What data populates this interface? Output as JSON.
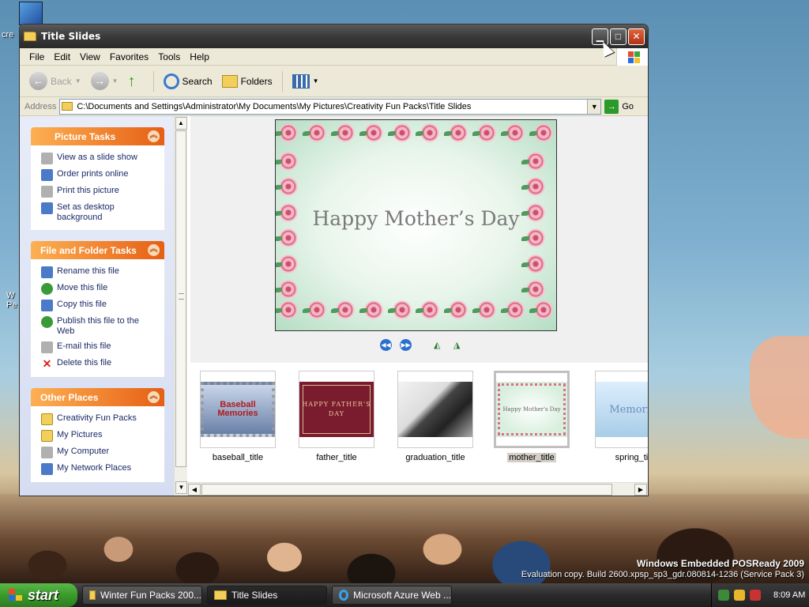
{
  "desktop": {
    "icon_label": "cre",
    "frag1": "W",
    "frag2": "Pe",
    "watermark_line1": "Windows Embedded POSReady 2009",
    "watermark_line2": "Evaluation copy. Build 2600.xpsp_sp3_gdr.080814-1236 (Service Pack 3)"
  },
  "window": {
    "title": "Title Slides",
    "controls": {
      "minimize": "▁",
      "maximize": "□",
      "close": "✕"
    }
  },
  "menu": [
    "File",
    "Edit",
    "View",
    "Favorites",
    "Tools",
    "Help"
  ],
  "toolbar": {
    "back": "Back",
    "search": "Search",
    "folders": "Folders"
  },
  "address": {
    "label": "Address",
    "path": "C:\\Documents and Settings\\Administrator\\My Documents\\My Pictures\\Creativity Fun Packs\\Title Slides",
    "go": "Go"
  },
  "left_panels": {
    "picture_tasks": {
      "title": "Picture Tasks",
      "items": [
        "View as a slide show",
        "Order prints online",
        "Print this picture",
        "Set as desktop background"
      ]
    },
    "file_tasks": {
      "title": "File and Folder Tasks",
      "items": [
        "Rename this file",
        "Move this file",
        "Copy this file",
        "Publish this file to the Web",
        "E-mail this file",
        "Delete this file"
      ]
    },
    "other_places": {
      "title": "Other Places",
      "items": [
        "Creativity Fun Packs",
        "My Pictures",
        "My Computer",
        "My Network Places"
      ]
    }
  },
  "preview": {
    "text": "Happy Mother’s Day"
  },
  "thumbnails": [
    {
      "name": "baseball_title",
      "text": "Baseball Memories"
    },
    {
      "name": "father_title",
      "text": "HAPPY FATHER'S DAY"
    },
    {
      "name": "graduation_title",
      "text": ""
    },
    {
      "name": "mother_title",
      "text": "Happy Mother's Day",
      "selected": true
    },
    {
      "name": "spring_tit",
      "text": "Memorie"
    }
  ],
  "taskbar": {
    "start": "start",
    "buttons": [
      "Winter Fun Packs 200...",
      "Title Slides",
      "Microsoft Azure Web ..."
    ],
    "clock": "8:09 AM"
  }
}
